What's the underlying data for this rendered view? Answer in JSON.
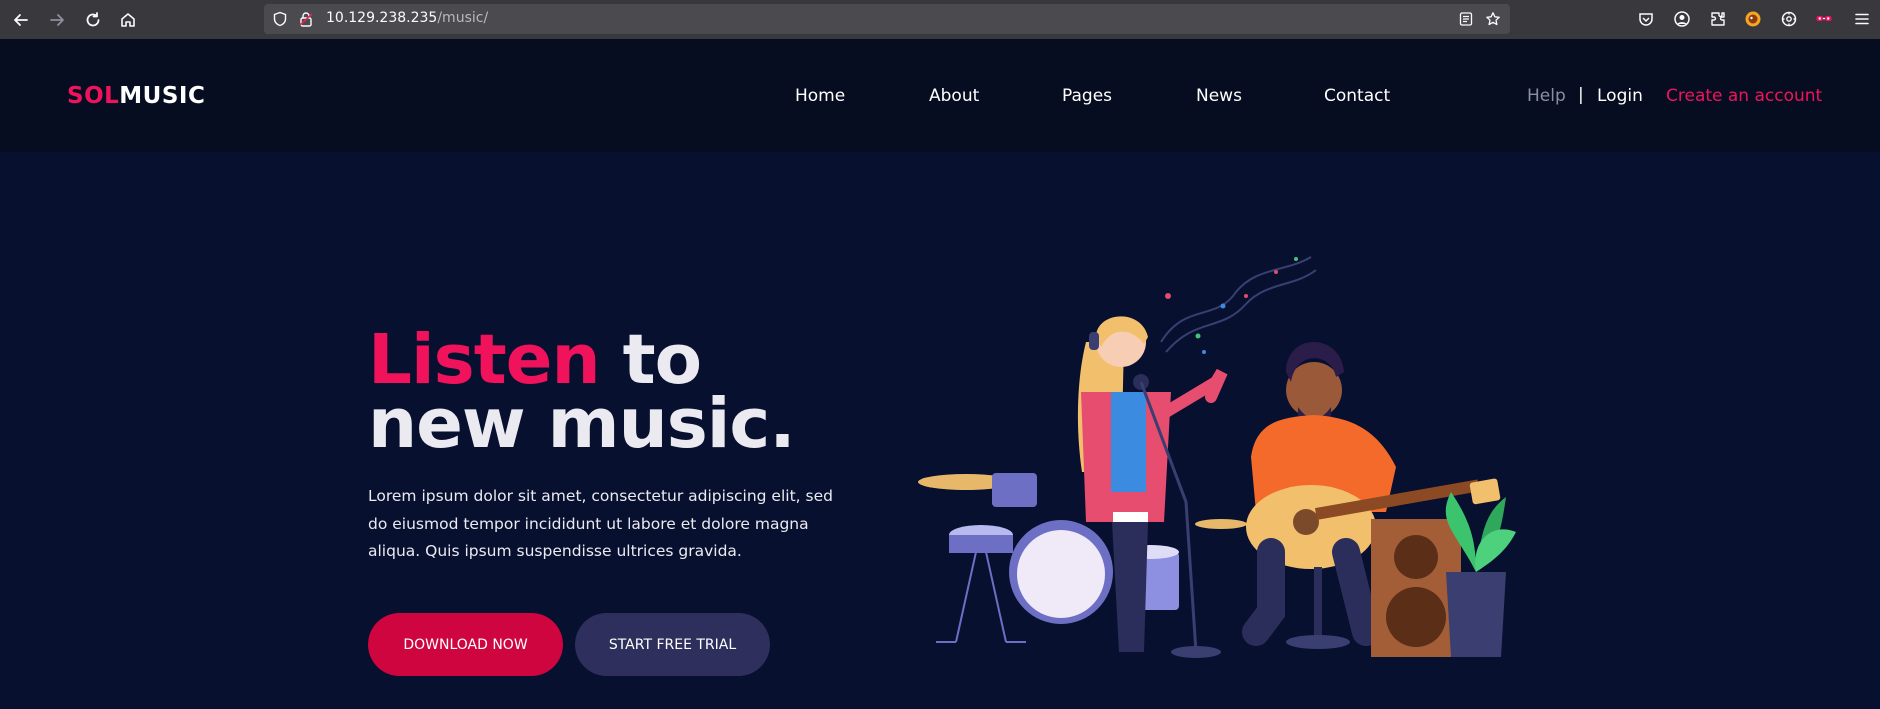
{
  "browser": {
    "url_host": "10.129.238.235",
    "url_path": "/music/",
    "icons": [
      "back-icon",
      "forward-icon",
      "reload-icon",
      "home-icon",
      "shield-icon",
      "lock-icon",
      "reader-view-icon",
      "bookmark-star-icon",
      "pocket-icon",
      "account-icon",
      "extensions-icon",
      "extension-fox-icon",
      "extension-gear-icon",
      "extension-glasses-icon",
      "menu-icon"
    ]
  },
  "site": {
    "logo_sol": "SOL",
    "logo_music": "MUSIC",
    "nav": [
      "Home",
      "About",
      "Pages",
      "News",
      "Contact"
    ],
    "help": "Help",
    "separator": "|",
    "login": "Login",
    "create_account": "Create an account"
  },
  "hero": {
    "headline_accent": "Listen",
    "headline_rest1": "to",
    "headline_rest2": "new music.",
    "description": "Lorem ipsum dolor sit amet, consectetur adipiscing elit, sed do eiusmod tempor incididunt ut labore et dolore magna aliqua. Quis ipsum suspendisse ultrices gravida.",
    "primary_button": "DOWNLOAD NOW",
    "secondary_button": "START FREE TRIAL"
  },
  "colors": {
    "accent": "#f0135c",
    "header_bg": "#060d21",
    "hero_bg": "#081030",
    "primary_btn": "#cf0540",
    "secondary_btn": "#2e2f5d"
  }
}
